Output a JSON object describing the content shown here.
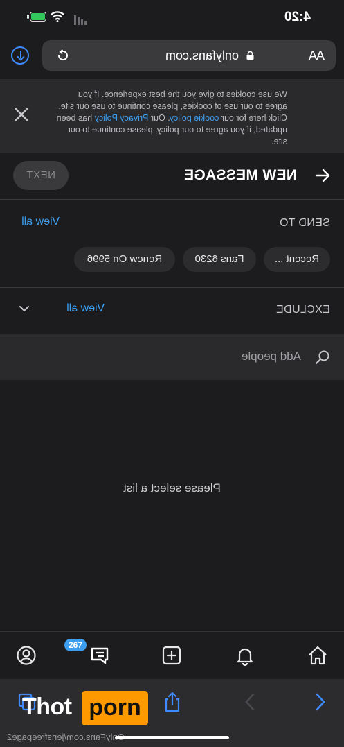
{
  "status_bar": {
    "time": "4:20"
  },
  "browser": {
    "domain": "onlyfans.com",
    "text_size_label": "AA",
    "footer_url": "OnlyFans.com/jensfreepage2"
  },
  "cookie_banner": {
    "text_1": "We use cookies to give you the best experience. If you agree to our use of cookies, please continue to use our site. Click here for our",
    "cookie_policy_link": "cookie policy",
    "text_2": ". Our",
    "privacy_link": "Privacy Policy",
    "text_3": "has been updated, if you agree to our policy, please continue to our site."
  },
  "header": {
    "title": "NEW MESSAGE",
    "next_label": "NEXT"
  },
  "send_to": {
    "label": "SEND TO",
    "view_all": "View all",
    "chips": [
      "Recent ...",
      "Fans 6230",
      "Renew On 5996"
    ]
  },
  "exclude": {
    "label": "EXCLUDE",
    "view_all": "View all"
  },
  "add_people": {
    "placeholder": "Add people"
  },
  "empty_state": {
    "message": "Please select a list"
  },
  "bottom_nav": {
    "messages_badge": "267"
  },
  "watermark": {
    "part1": "Thot",
    "part2": "porn"
  },
  "colors": {
    "accent": "#3d9ef0",
    "background": "#1c1c1e",
    "watermark": "#ff9900"
  }
}
